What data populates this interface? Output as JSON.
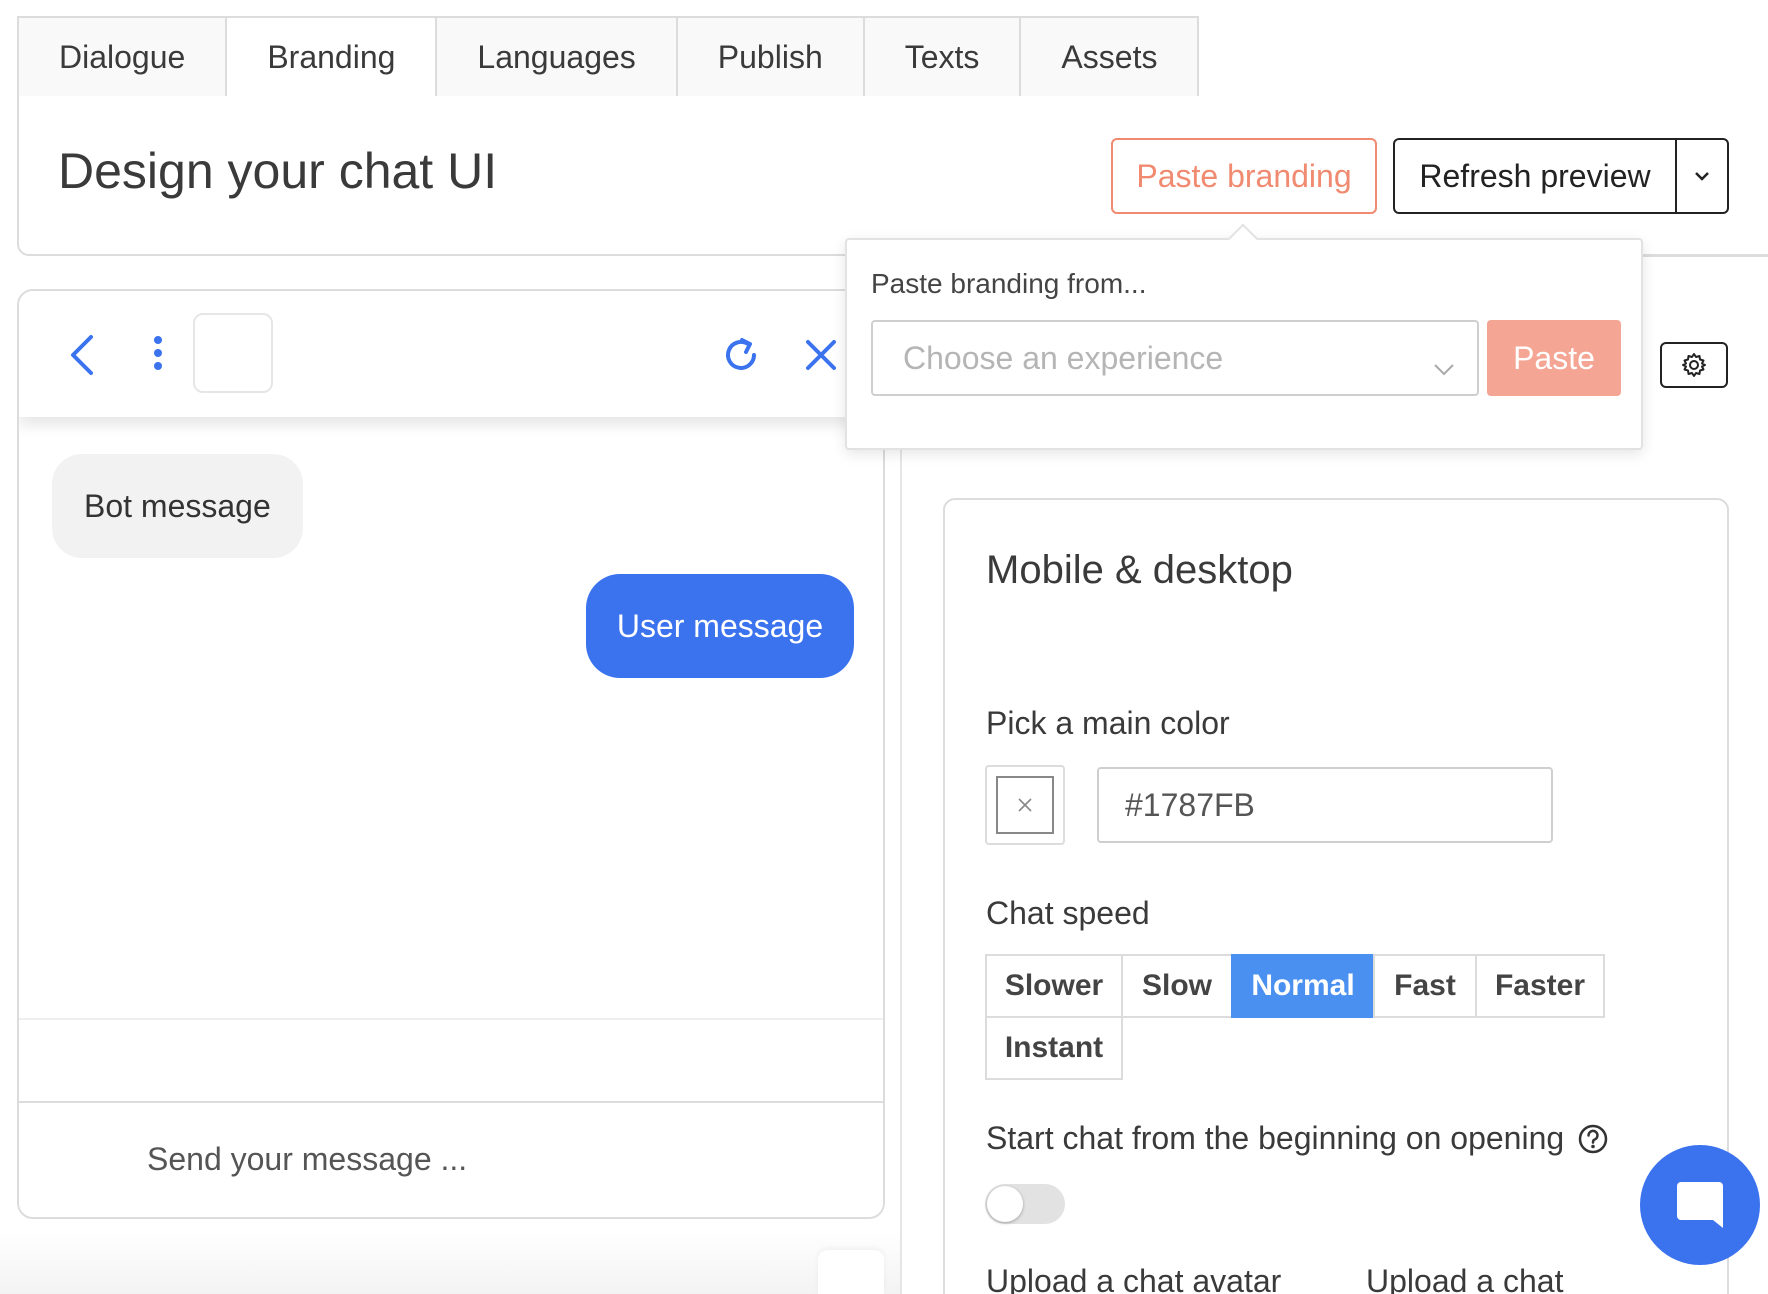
{
  "tabs": [
    {
      "label": "Dialogue",
      "active": false
    },
    {
      "label": "Branding",
      "active": true
    },
    {
      "label": "Languages",
      "active": false
    },
    {
      "label": "Publish",
      "active": false
    },
    {
      "label": "Texts",
      "active": false
    },
    {
      "label": "Assets",
      "active": false
    }
  ],
  "header": {
    "title": "Design your chat UI",
    "paste_branding_label": "Paste branding",
    "refresh_preview_label": "Refresh preview"
  },
  "popover": {
    "title": "Paste branding from...",
    "select_placeholder": "Choose an experience",
    "paste_label": "Paste"
  },
  "chat_preview": {
    "bot_message": "Bot message",
    "user_message": "User message",
    "input_placeholder": "Send your message ..."
  },
  "settings": {
    "section_title": "Mobile & desktop",
    "main_color_label": "Pick a main color",
    "main_color_value": "#1787FB",
    "chat_speed_label": "Chat speed",
    "speed_options": [
      {
        "label": "Slower",
        "active": false
      },
      {
        "label": "Slow",
        "active": false
      },
      {
        "label": "Normal",
        "active": true
      },
      {
        "label": "Fast",
        "active": false
      },
      {
        "label": "Faster",
        "active": false
      },
      {
        "label": "Instant",
        "active": false
      }
    ],
    "start_from_beginning_label": "Start chat from the beginning on opening",
    "start_from_beginning_enabled": false,
    "upload_avatar_label": "Upload a chat avatar",
    "upload_chat_label": "Upload a chat"
  },
  "colors": {
    "accent_orange": "#f08a70",
    "paste_button": "#f4a593",
    "primary_blue": "#3b73ef",
    "speed_active": "#4a90f0"
  }
}
